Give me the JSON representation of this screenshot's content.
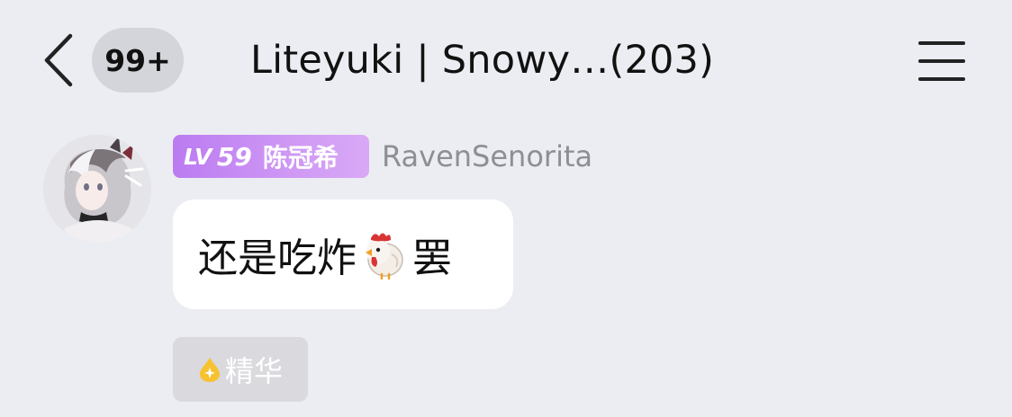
{
  "header": {
    "back_icon": "chevron-left-icon",
    "unread_badge": "99+",
    "title": "Liteyuki | Snowy…(203)",
    "menu_icon": "hamburger-menu-icon"
  },
  "message": {
    "avatar_icon": "user-avatar",
    "level_badge": {
      "lv_prefix": "LV",
      "lv_number": "59",
      "title": "陈冠希",
      "color": "#c28af3"
    },
    "sender_name": "RavenSenorita",
    "content_before": "还是吃炸",
    "emoji_icon": "chicken-emoji-icon",
    "content_after": "罢",
    "essence_tag": {
      "icon": "essence-drop-icon",
      "label": "精华",
      "icon_color": "#f7c22f"
    }
  },
  "colors": {
    "background": "#ecedf2",
    "bubble": "#ffffff",
    "muted_text": "#8e8e93",
    "badge_background": "#d4d5da"
  }
}
